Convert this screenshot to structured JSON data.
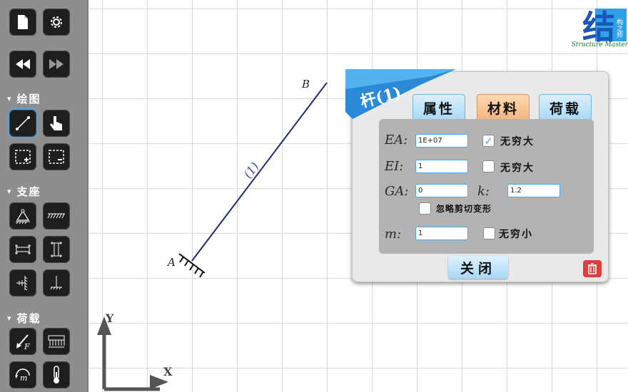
{
  "toolbar": {
    "sections": {
      "draw": "绘图",
      "support": "支座",
      "load": "荷载"
    },
    "icons": [
      "new-file-icon",
      "gear-icon",
      "rewind-icon",
      "fast-forward-icon",
      "draw-member-icon",
      "pointer-hand-icon",
      "select-add-icon",
      "select-remove-icon",
      "hinge-support-icon",
      "fixed-ground-icon",
      "roller-h-icon",
      "roller-v-icon",
      "slide-support-icon",
      "fixed-support-icon",
      "force-icon",
      "distributed-load-icon",
      "moment-icon",
      "temperature-icon"
    ],
    "force_symbol": "F",
    "moment_symbol": "m"
  },
  "canvas": {
    "node_a": "A",
    "node_b": "B",
    "member_label": "(1)",
    "axis_x": "X",
    "axis_y": "Y"
  },
  "logo": {
    "glyph": "结",
    "mini": "构之师",
    "sub": "Structure Master"
  },
  "dialog": {
    "title": "杆(1)",
    "tabs": [
      {
        "label": "属性",
        "active": false
      },
      {
        "label": "材料",
        "active": true
      },
      {
        "label": "荷载",
        "active": false
      }
    ],
    "fields": {
      "ea": {
        "label": "EA:",
        "value": "1E+07",
        "checkbox_label": "无穷大",
        "checked": true
      },
      "ei": {
        "label": "EI:",
        "value": "1",
        "checkbox_label": "无穷大",
        "checked": false
      },
      "ga": {
        "label": "GA:",
        "value": "0"
      },
      "k": {
        "label": "k:",
        "value": "1.2"
      },
      "ignore_shear": {
        "label": "忽略剪切变形",
        "checked": false
      },
      "m": {
        "label": "m:",
        "value": "1",
        "checkbox_label": "无穷小",
        "checked": false
      }
    },
    "close_label": "关闭"
  },
  "colors": {
    "accent": "#49a9e6",
    "member": "#1e2a78",
    "tab_active": "#f3b57c",
    "delete": "#e13d3d"
  }
}
